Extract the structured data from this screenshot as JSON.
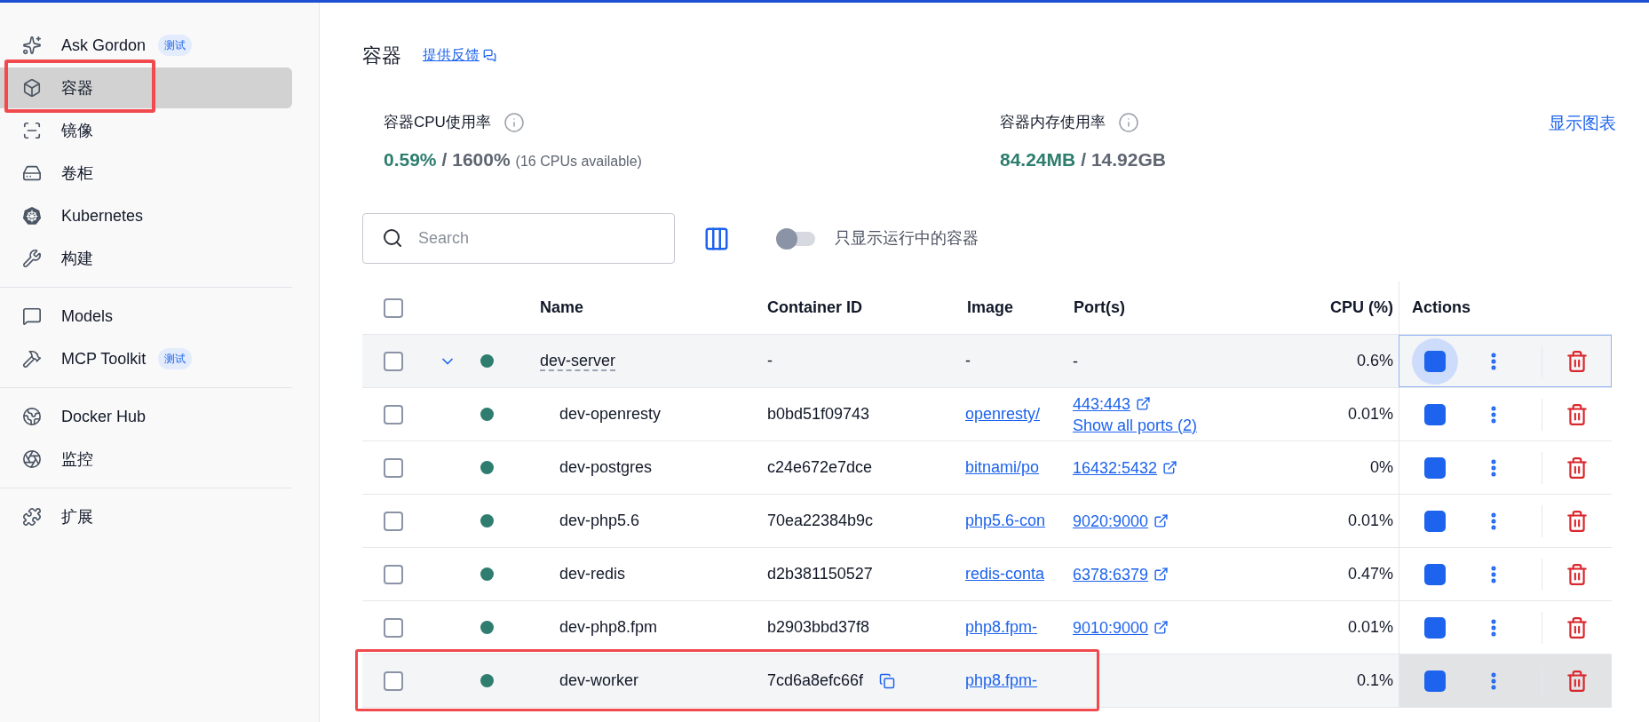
{
  "sidebar": {
    "groups": [
      {
        "items": [
          {
            "label": "Ask Gordon",
            "badge": "测试",
            "selected": false,
            "outlined": false
          },
          {
            "label": "容器",
            "selected": true,
            "outlined": true
          },
          {
            "label": "镜像",
            "selected": false,
            "outlined": false
          },
          {
            "label": "卷柜",
            "selected": false,
            "outlined": false
          },
          {
            "label": "Kubernetes",
            "selected": false,
            "outlined": false
          },
          {
            "label": "构建",
            "selected": false,
            "outlined": false
          }
        ]
      },
      {
        "items": [
          {
            "label": "Models",
            "selected": false,
            "outlined": false
          },
          {
            "label": "MCP Toolkit",
            "badge": "测试",
            "selected": false,
            "outlined": false
          }
        ]
      },
      {
        "items": [
          {
            "label": "Docker Hub",
            "selected": false,
            "outlined": false
          },
          {
            "label": "监控",
            "selected": false,
            "outlined": false
          }
        ]
      },
      {
        "items": [
          {
            "label": "扩展",
            "selected": false,
            "outlined": false
          }
        ]
      }
    ]
  },
  "header": {
    "title": "容器",
    "feedback": "提供反馈"
  },
  "stats": [
    {
      "label": "容器CPU使用率",
      "value": "0.59%",
      "total": "/ 1600%",
      "note": "(16 CPUs available)"
    },
    {
      "label": "容器内存使用率",
      "value": "84.24MB",
      "total": "/ 14.92GB"
    }
  ],
  "show_chart": "显示图表",
  "search": {
    "placeholder": "Search"
  },
  "running_toggle": {
    "label": "只显示运行中的容器",
    "on": false
  },
  "table": {
    "select_all": {
      "checked": false
    },
    "columns": [
      "Name",
      "Container ID",
      "Image",
      "Port(s)",
      "CPU (%)",
      "Actions"
    ],
    "rows": [
      {
        "kind": "group",
        "name": "dev-server",
        "id": "-",
        "image": "-",
        "ports": [
          {
            "label": "-",
            "kind": "text"
          }
        ],
        "cpu": "0.6%",
        "running": true,
        "checked": false,
        "expanded": true,
        "focused": true,
        "hovered": false,
        "outlined": false,
        "children": [
          {
            "kind": "container",
            "name": "dev-openresty",
            "id": "b0bd51f09743",
            "image": "openresty/",
            "ports": [
              {
                "label": "443:443",
                "kind": "port"
              },
              {
                "label": "Show all ports (2)",
                "kind": "more"
              }
            ],
            "cpu": "0.01%",
            "running": true,
            "checked": false,
            "focused": false,
            "hovered": false,
            "outlined": false
          },
          {
            "kind": "container",
            "name": "dev-postgres",
            "id": "c24e672e7dce",
            "image": "bitnami/po",
            "ports": [
              {
                "label": "16432:5432",
                "kind": "port"
              }
            ],
            "cpu": "0%",
            "running": true,
            "checked": false,
            "focused": false,
            "hovered": false,
            "outlined": false
          },
          {
            "kind": "container",
            "name": "dev-php5.6",
            "id": "70ea22384b9c",
            "image": "php5.6-con",
            "ports": [
              {
                "label": "9020:9000",
                "kind": "port"
              }
            ],
            "cpu": "0.01%",
            "running": true,
            "checked": false,
            "focused": false,
            "hovered": false,
            "outlined": false
          },
          {
            "kind": "container",
            "name": "dev-redis",
            "id": "d2b381150527",
            "image": "redis-conta",
            "ports": [
              {
                "label": "6378:6379",
                "kind": "port"
              }
            ],
            "cpu": "0.47%",
            "running": true,
            "checked": false,
            "focused": false,
            "hovered": false,
            "outlined": false
          },
          {
            "kind": "container",
            "name": "dev-php8.fpm",
            "id": "b2903bbd37f8",
            "image": "php8.fpm-",
            "ports": [
              {
                "label": "9010:9000",
                "kind": "port"
              }
            ],
            "cpu": "0.01%",
            "running": true,
            "checked": false,
            "focused": false,
            "hovered": false,
            "outlined": false
          },
          {
            "kind": "container",
            "name": "dev-worker",
            "id": "7cd6a8efc66f",
            "image": "php8.fpm-",
            "cpu": "0.1%",
            "running": true,
            "checked": false,
            "focused": false,
            "hovered": true,
            "outlined": true
          }
        ]
      }
    ]
  }
}
